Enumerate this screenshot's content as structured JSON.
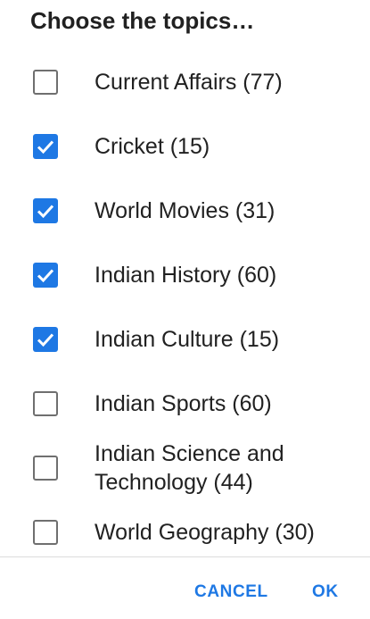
{
  "dialog": {
    "title": "Choose the topics…",
    "items": [
      {
        "label": "Current Affairs (77)",
        "checked": false
      },
      {
        "label": "Cricket (15)",
        "checked": true
      },
      {
        "label": "World Movies (31)",
        "checked": true
      },
      {
        "label": "Indian History (60)",
        "checked": true
      },
      {
        "label": "Indian Culture (15)",
        "checked": true
      },
      {
        "label": "Indian Sports (60)",
        "checked": false
      },
      {
        "label_line1": "Indian Science and",
        "label_line2": "Technology (44)",
        "checked": false
      },
      {
        "label": "World Geography (30)",
        "checked": false
      }
    ],
    "buttons": {
      "cancel": "CANCEL",
      "ok": "OK"
    }
  },
  "colors": {
    "accent": "#1e78e4",
    "checkbox_border": "#6f6f6f",
    "text": "#212121"
  }
}
